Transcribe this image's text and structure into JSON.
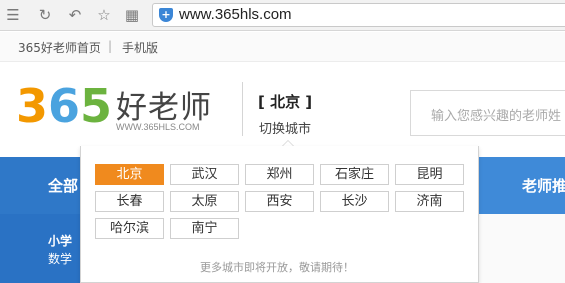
{
  "browser": {
    "url": "www.365hls.com",
    "security_icon": "shield-plus-icon",
    "nav_icons": [
      "menu-icon",
      "refresh-icon",
      "back-icon",
      "star-icon",
      "grid-icon"
    ]
  },
  "topnav": {
    "home": "365好老师首页",
    "separator": "|",
    "mobile": "手机版"
  },
  "logo": {
    "digits": [
      "3",
      "6",
      "5"
    ],
    "digit_colors": [
      "#f39800",
      "#4aa3df",
      "#6cb33f"
    ],
    "name": "好老师",
    "subtitle": "WWW.365HLS.COM"
  },
  "city": {
    "current": "[ 北京 ]",
    "switch_label": "切换城市"
  },
  "search": {
    "placeholder": "输入您感兴趣的老师姓"
  },
  "nav": {
    "all_label": "全部",
    "teacher_label": "老师推",
    "grade": "小学",
    "subject": "数学"
  },
  "dropdown": {
    "cities": [
      {
        "name": "北京",
        "active": true
      },
      {
        "name": "武汉",
        "active": false
      },
      {
        "name": "郑州",
        "active": false
      },
      {
        "name": "石家庄",
        "active": false
      },
      {
        "name": "昆明",
        "active": false
      },
      {
        "name": "长春",
        "active": false
      },
      {
        "name": "太原",
        "active": false
      },
      {
        "name": "西安",
        "active": false
      },
      {
        "name": "长沙",
        "active": false
      },
      {
        "name": "济南",
        "active": false
      },
      {
        "name": "哈尔滨",
        "active": false
      },
      {
        "name": "南宁",
        "active": false
      }
    ],
    "more_note": "更多城市即将开放，敬请期待！"
  },
  "colors": {
    "brand_blue": "#3f8ad8",
    "active_orange": "#f08a1e"
  }
}
